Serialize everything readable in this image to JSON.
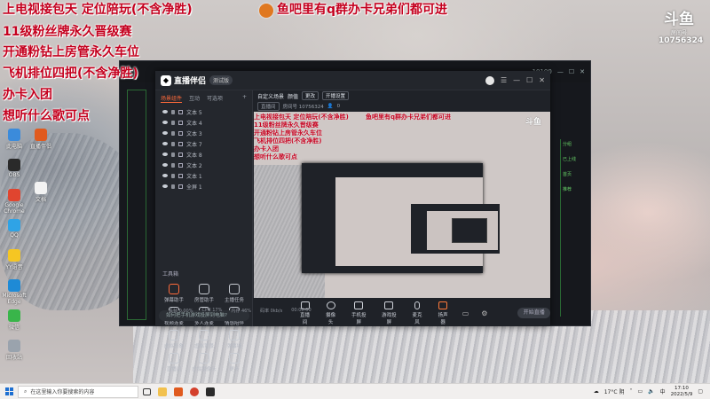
{
  "overlay": {
    "lines": [
      "上电视接包天 定位陪玩(不含净胜)",
      "11级粉丝牌永久晋级赛",
      "开通粉钻上房管永久车位",
      "飞机排位四把(不含净胜)",
      "办卡入团",
      "想听什么歌可点"
    ],
    "top_notice": "鱼吧里有q群办卡兄弟们都可进"
  },
  "watermark": {
    "logo": "斗鱼",
    "sub": "房间号",
    "room_id": "10756324"
  },
  "desktop_icons": [
    {
      "label": "此电脑",
      "color": "#3b8bdb"
    },
    {
      "label": "OBS",
      "color": "#2a2a2a"
    },
    {
      "label": "Google Chrome",
      "color": "#e0452f"
    },
    {
      "label": "QQ",
      "color": "#2fa3e6"
    },
    {
      "label": "YY语音",
      "color": "#f5c623"
    },
    {
      "label": "Microsoft Edge",
      "color": "#1e8ad6"
    },
    {
      "label": "微信",
      "color": "#39b54a"
    },
    {
      "label": "回收站",
      "color": "#9aa3ad"
    }
  ],
  "desktop_icons_col2": [
    {
      "label": "直播伴侣",
      "color": "#e05a1e"
    },
    {
      "label": "文档",
      "color": "#f3f3f3"
    }
  ],
  "bg_window": {
    "right_items": [
      "分组",
      "已上线",
      "首页",
      "推荐"
    ],
    "top_counter": "10100"
  },
  "app": {
    "logo": "直播伴侣",
    "version": "测试版",
    "side_tabs": [
      "场景组件",
      "互动",
      "可选项"
    ],
    "layers": [
      "文本 5",
      "文本 4",
      "文本 3",
      "文本 7",
      "文本 8",
      "文本 2",
      "文本 1",
      "全屏 1"
    ],
    "tools_title": "工具箱",
    "tools": [
      "弹幕助手",
      "房管助手",
      "主播任务",
      "视频连麦",
      "多人连麦",
      "情感陪伴",
      "虚拟形象",
      "虚拟背景",
      "弹幕墙",
      "直播间",
      "虚拟摄像头",
      "更多"
    ],
    "side_bottom": "如何把手机游戏投屏到电脑?",
    "info_title": "自定义场景",
    "info_category": "颜值",
    "info_btn1": "更改",
    "info_btn2": "开播设置",
    "info_room": "房间号 10756324",
    "info_tags": "直播间",
    "info_viewers": "0",
    "controls": [
      "直播间",
      "摄像头",
      "手机投屏",
      "游戏投屏",
      "麦克风",
      "扬声器"
    ],
    "go_live": "开始直播",
    "status": [
      "丢帧 0.00%",
      "CPU 17%",
      "内存 46%",
      "码率 0kb/s",
      "00:00:00"
    ]
  },
  "taskbar": {
    "search_placeholder": "在这里输入你要搜索的内容",
    "weather": "17°C 阴",
    "ime": "中",
    "time": "17:10",
    "date": "2022/5/9"
  }
}
